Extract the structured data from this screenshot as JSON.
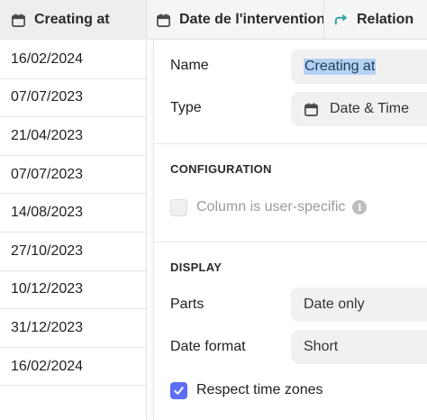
{
  "table": {
    "columns": [
      {
        "label": "Creating at",
        "icon": "calendar-icon"
      },
      {
        "label": "Date de l'intervention",
        "icon": "calendar-icon"
      },
      {
        "label": "Relation",
        "icon": "relation-arrow-icon"
      }
    ],
    "rows": [
      "16/02/2024",
      "07/07/2023",
      "21/04/2023",
      "07/07/2023",
      "14/08/2023",
      "27/10/2023",
      "10/12/2023",
      "31/12/2023",
      "16/02/2024",
      ""
    ]
  },
  "panel": {
    "name_label": "Name",
    "name_value": "Creating at",
    "type_label": "Type",
    "type_value": "Date & Time",
    "type_icon": "calendar-icon",
    "configuration_title": "CONFIGURATION",
    "user_specific_label": "Column is user-specific",
    "user_specific_checked": false,
    "display_title": "DISPLAY",
    "parts_label": "Parts",
    "parts_value": "Date only",
    "date_format_label": "Date format",
    "date_format_value": "Short",
    "time_zones_label": "Respect time zones",
    "time_zones_checked": true,
    "info_glyph": "i"
  },
  "colors": {
    "accent": "#5b6ef5",
    "selection": "#b5d2f5",
    "field_bg": "#f1f1f1",
    "relation_icon": "#2aa5a0"
  }
}
